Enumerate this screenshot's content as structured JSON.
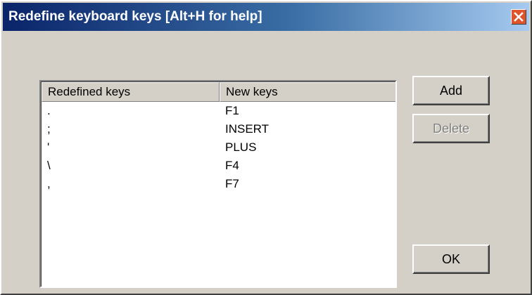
{
  "window": {
    "title": "Redefine keyboard keys [Alt+H for help]"
  },
  "list": {
    "columns": [
      "Redefined keys",
      "New keys"
    ],
    "rows": [
      [
        ".",
        "F1"
      ],
      [
        ";",
        "INSERT"
      ],
      [
        "'",
        "PLUS"
      ],
      [
        "\\",
        "F4"
      ],
      [
        ",",
        "F7"
      ]
    ]
  },
  "buttons": {
    "add": "Add",
    "delete": "Delete",
    "ok": "OK"
  },
  "colors": {
    "title_gradient_start": "#0a246a",
    "title_gradient_end": "#a6caf0",
    "dialog_face": "#d4d0c8",
    "close_button": "#e0542c"
  },
  "icons": {
    "close": "close-icon"
  }
}
